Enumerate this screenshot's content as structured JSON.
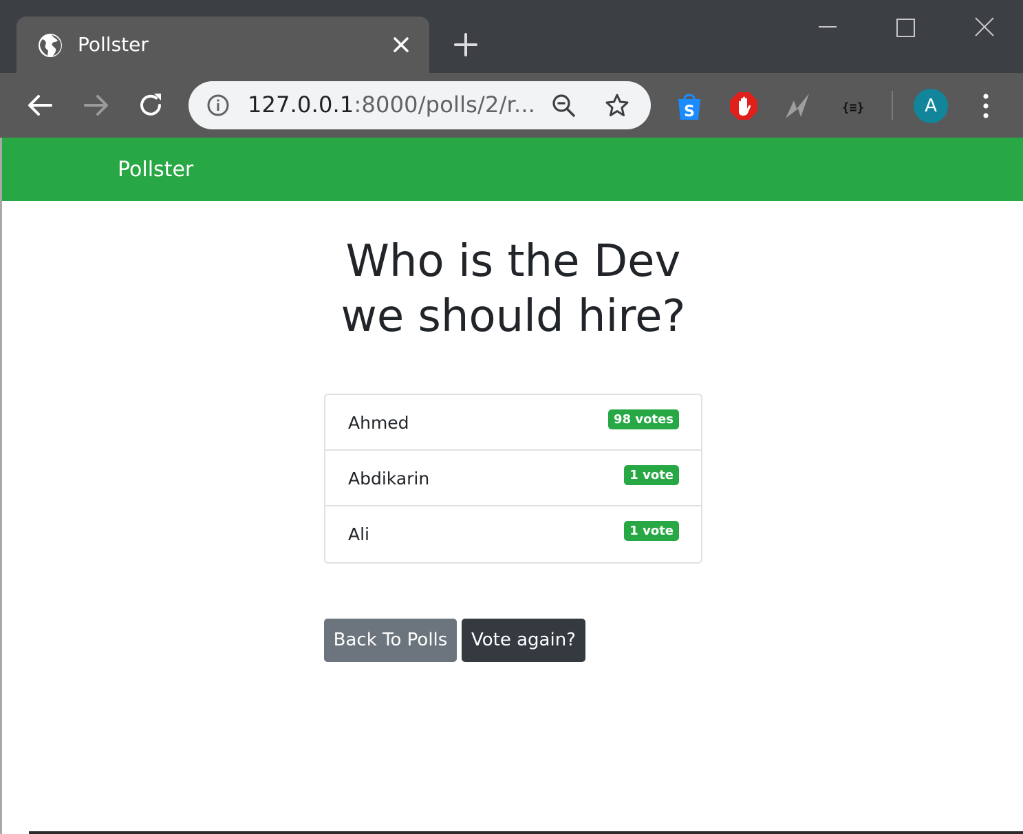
{
  "browser": {
    "tab_title": "Pollster",
    "url_host": "127.0.0.1",
    "url_rest": ":8000/polls/2/r...",
    "avatar_letter": "A",
    "icons": {
      "favicon": "globe-icon",
      "tab_close": "close-icon",
      "new_tab": "plus-icon",
      "back": "arrow-left-icon",
      "forward": "arrow-right-icon",
      "reload": "reload-icon",
      "site_info": "info-icon",
      "zoom": "zoom-out-icon",
      "bookmark": "star-icon",
      "ext_1": "shopping-s-icon",
      "ext_2": "adblock-hand-icon",
      "ext_3": "lightning-icon",
      "ext_4": "json-braces-icon",
      "menu": "kebab-menu-icon"
    }
  },
  "navbar": {
    "brand": "Pollster",
    "color": "#28a745"
  },
  "poll": {
    "question_line1": "Who is the Dev",
    "question_line2": "we should hire?",
    "results": [
      {
        "name": "Ahmed",
        "votes_label": "98 votes"
      },
      {
        "name": "Abdikarin",
        "votes_label": "1 vote"
      },
      {
        "name": "Ali",
        "votes_label": "1 vote"
      }
    ],
    "badge_color": "#28a745"
  },
  "actions": {
    "back_label": "Back To Polls",
    "vote_again_label": "Vote again?"
  }
}
